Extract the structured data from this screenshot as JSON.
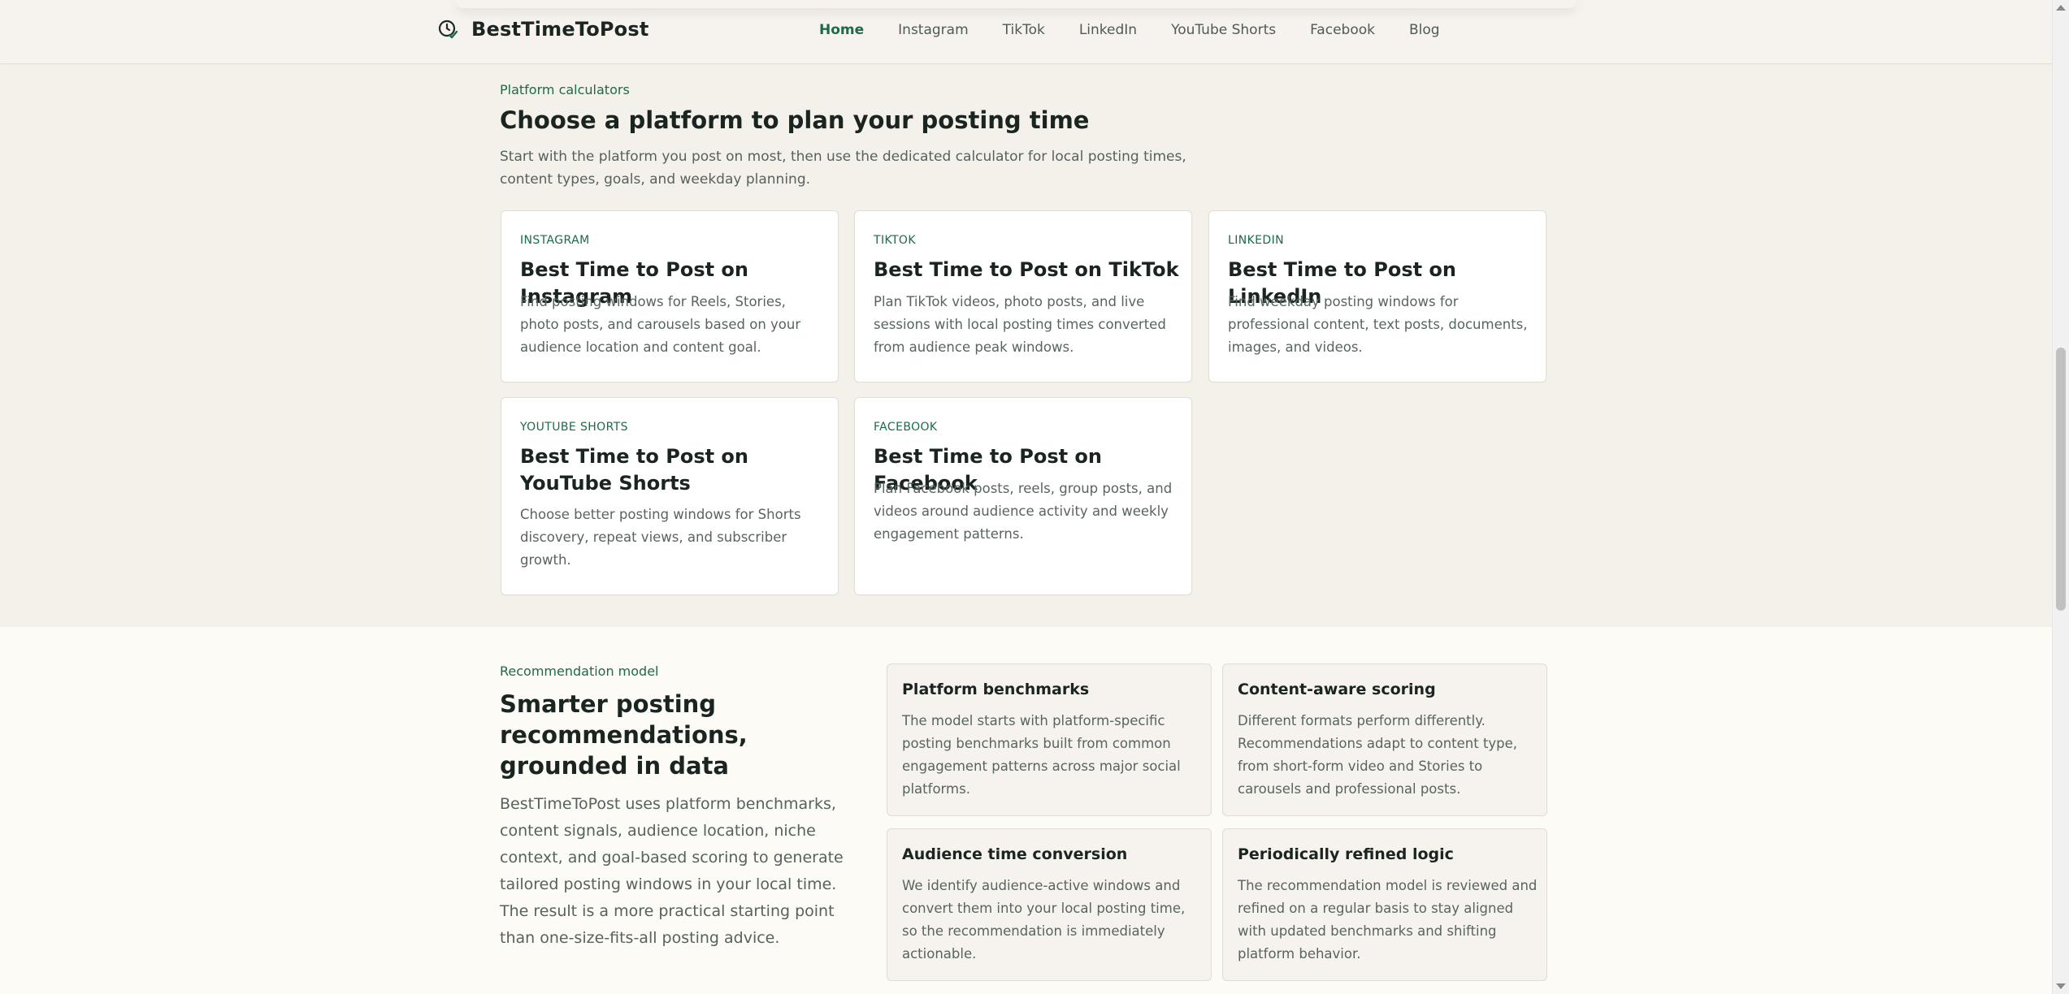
{
  "header": {
    "brand_name": "BestTimeToPost",
    "logo_icon": "clock-check-icon",
    "nav": [
      {
        "label": "Home",
        "active": true
      },
      {
        "label": "Instagram",
        "active": false
      },
      {
        "label": "TikTok",
        "active": false
      },
      {
        "label": "LinkedIn",
        "active": false
      },
      {
        "label": "YouTube Shorts",
        "active": false
      },
      {
        "label": "Facebook",
        "active": false
      },
      {
        "label": "Blog",
        "active": false
      }
    ]
  },
  "platforms_section": {
    "eyebrow": "Platform calculators",
    "title": "Choose a platform to plan your posting time",
    "lead_line1": "Start with the platform you post on most, then use the dedicated calculator for local posting times,",
    "lead_line2": "content types, goals, and weekday planning.",
    "cards": [
      {
        "tag": "INSTAGRAM",
        "title": "Best Time to Post on Instagram",
        "desc": "Find posting windows for Reels, Stories, photo posts, and carousels based on your audience location and content goal."
      },
      {
        "tag": "TIKTOK",
        "title": "Best Time to Post on TikTok",
        "desc": "Plan TikTok videos, photo posts, and live sessions with local posting times converted from audience peak windows."
      },
      {
        "tag": "LINKEDIN",
        "title": "Best Time to Post on LinkedIn",
        "desc": "Find weekday posting windows for professional content, text posts, documents, images, and videos."
      },
      {
        "tag": "YOUTUBE SHORTS",
        "title": "Best Time to Post on YouTube Shorts",
        "desc": "Choose better posting windows for Shorts discovery, repeat views, and subscriber growth."
      },
      {
        "tag": "FACEBOOK",
        "title": "Best Time to Post on Facebook",
        "desc": "Plan Facebook posts, reels, group posts, and videos around audience activity and weekly engagement patterns."
      }
    ]
  },
  "recommendation_section": {
    "eyebrow": "Recommendation model",
    "title": "Smarter posting recommendations, grounded in data",
    "lead": "BestTimeToPost uses platform benchmarks, content signals, audience location, niche context, and goal-based scoring to generate tailored posting windows in your local time. The result is a more practical starting point than one-size-fits-all posting advice.",
    "features": [
      {
        "title": "Platform benchmarks",
        "desc": "The model starts with platform-specific posting benchmarks built from common engagement patterns across major social platforms."
      },
      {
        "title": "Content-aware scoring",
        "desc": "Different formats perform differently. Recommendations adapt to content type, from short-form video and Stories to carousels and professional posts."
      },
      {
        "title": "Audience time conversion",
        "desc": "We identify audience-active windows and convert them into your local posting time, so the recommendation is immediately actionable."
      },
      {
        "title": "Periodically refined logic",
        "desc": "The recommendation model is reviewed and refined on a regular basis to stay aligned with updated benchmarks and shifting platform behavior."
      }
    ]
  },
  "colors": {
    "accent": "#1d6b46",
    "page_bg": "#f4f0ea",
    "section_alt_bg": "#fcfbf6",
    "card_bg": "#ffffff"
  }
}
